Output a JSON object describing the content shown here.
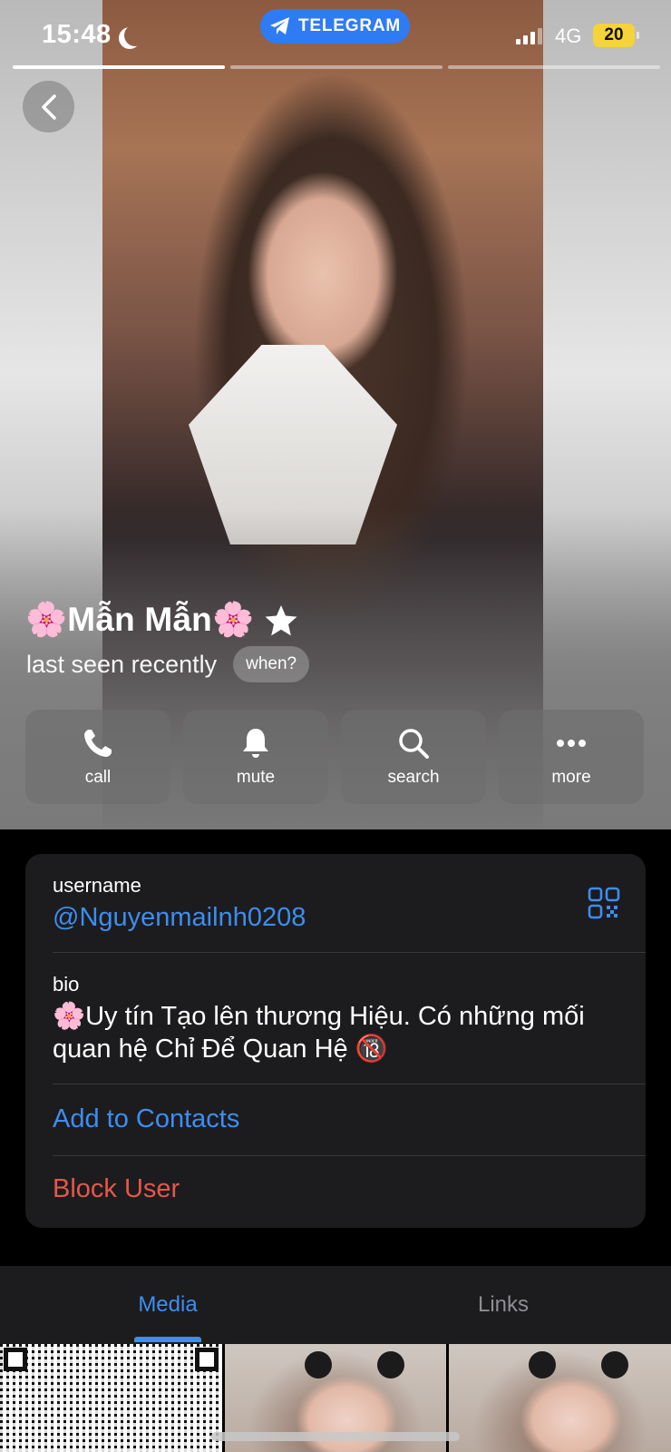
{
  "status_bar": {
    "time": "15:48",
    "app_pill": "TELEGRAM",
    "network": "4G",
    "battery": "20"
  },
  "profile": {
    "name": "🌸Mẫn Mẫn🌸",
    "last_seen": "last seen recently",
    "when_button": "when?",
    "star_icon": "star-icon"
  },
  "actions": [
    {
      "label": "call",
      "icon": "phone-icon"
    },
    {
      "label": "mute",
      "icon": "bell-icon"
    },
    {
      "label": "search",
      "icon": "search-icon"
    },
    {
      "label": "more",
      "icon": "more-dots-icon"
    }
  ],
  "info": {
    "username_label": "username",
    "username": "@Nguyenmailnh0208",
    "bio_label": "bio",
    "bio": "🌸Uy tín Tạo lên thương Hiệu. Có những mối quan hệ Chỉ Để Quan Hệ 🔞",
    "add_contact": "Add to Contacts",
    "block_user": "Block User"
  },
  "tabs": [
    {
      "label": "Media",
      "active": true
    },
    {
      "label": "Links",
      "active": false
    }
  ],
  "colors": {
    "accent": "#3e8df0",
    "danger": "#e5574b",
    "card_bg": "#1c1c1e",
    "telegram_pill": "#2f7bf4",
    "battery": "#f5d33a"
  }
}
